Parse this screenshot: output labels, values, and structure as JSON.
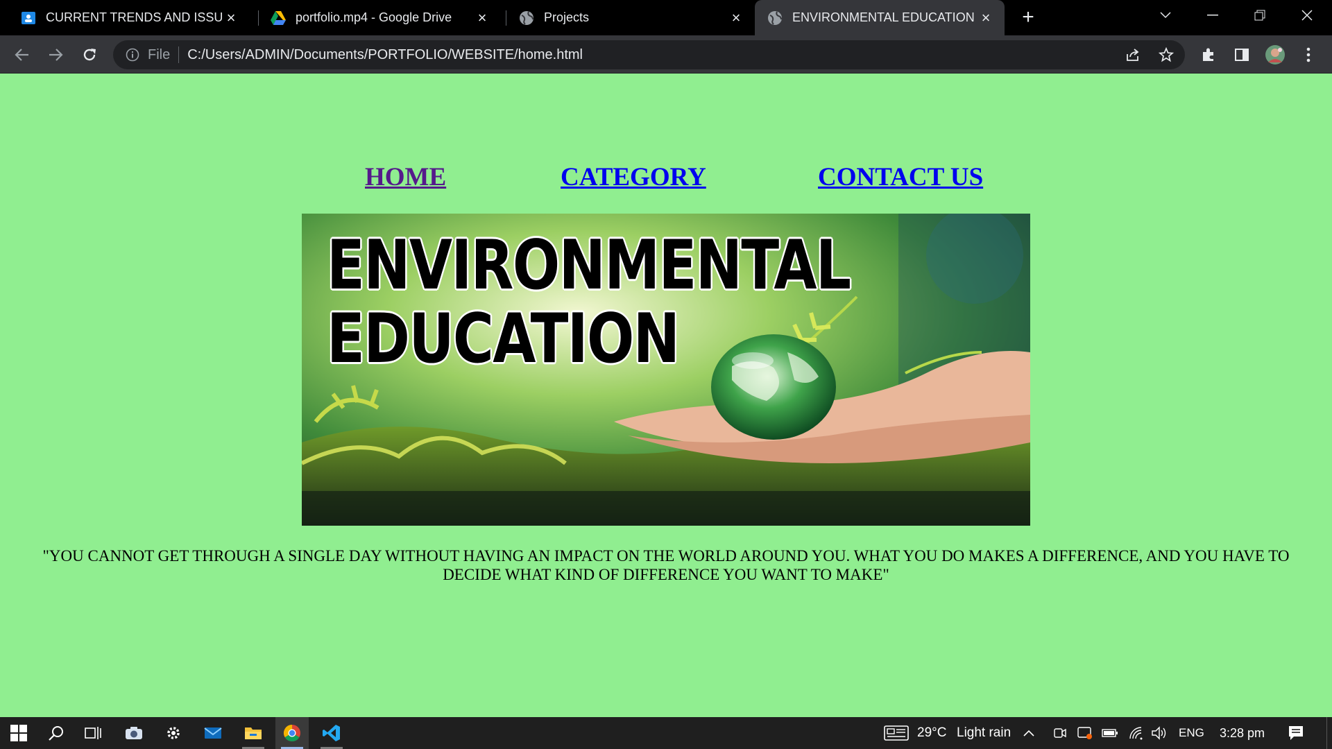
{
  "browser": {
    "tabs": [
      {
        "title": "CURRENT TRENDS AND ISSUES E",
        "icon": "classroom-icon"
      },
      {
        "title": "portfolio.mp4 - Google Drive",
        "icon": "google-drive-icon"
      },
      {
        "title": "Projects",
        "icon": "globe-icon"
      },
      {
        "title": "ENVIRONMENTAL EDUCATION",
        "icon": "globe-icon",
        "active": true
      }
    ],
    "omnibox": {
      "scheme_label": "File",
      "url": "C:/Users/ADMIN/Documents/PORTFOLIO/WEBSITE/home.html"
    }
  },
  "page": {
    "nav": {
      "home": "HOME",
      "category": "CATEGORY",
      "contact": "CONTACT US"
    },
    "banner": {
      "line1": "ENVIRONMENTAL",
      "line2": "EDUCATION"
    },
    "quote": "\"YOU CANNOT GET THROUGH A SINGLE DAY WITHOUT HAVING AN IMPACT ON THE WORLD AROUND YOU. WHAT YOU DO MAKES A DIFFERENCE, AND YOU HAVE TO DECIDE WHAT KIND OF DIFFERENCE YOU WANT TO MAKE\"",
    "background_color": "#90ee90"
  },
  "taskbar": {
    "weather_temp": "29°C",
    "weather_desc": "Light rain",
    "language": "ENG",
    "time": "3:28 pm"
  }
}
